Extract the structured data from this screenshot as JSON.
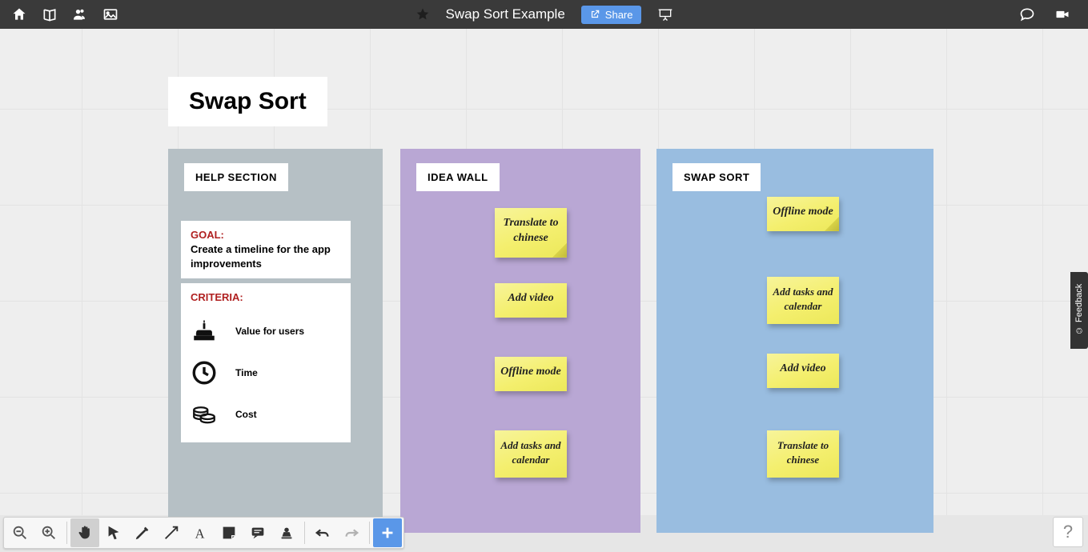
{
  "header": {
    "title": "Swap Sort Example",
    "share_label": "Share"
  },
  "board": {
    "title": "Swap Sort"
  },
  "help": {
    "label": "HELP SECTION",
    "goal_label": "GOAL:",
    "goal_text": "Create a timeline for the app improvements",
    "criteria_label": "CRITERIA:",
    "criteria": [
      {
        "label": "Value for users"
      },
      {
        "label": "Time"
      },
      {
        "label": "Cost"
      }
    ]
  },
  "idea_wall": {
    "label": "IDEA WALL",
    "notes": [
      "Translate to chinese",
      "Add video",
      "Offline mode",
      "Add tasks and calendar"
    ]
  },
  "swap_sort": {
    "label": "SWAP SORT",
    "notes": [
      "Offline mode",
      "Add tasks and calendar",
      "Add video",
      "Translate to chinese"
    ]
  },
  "feedback": {
    "label": "Feedback"
  },
  "help_button": {
    "label": "?"
  }
}
